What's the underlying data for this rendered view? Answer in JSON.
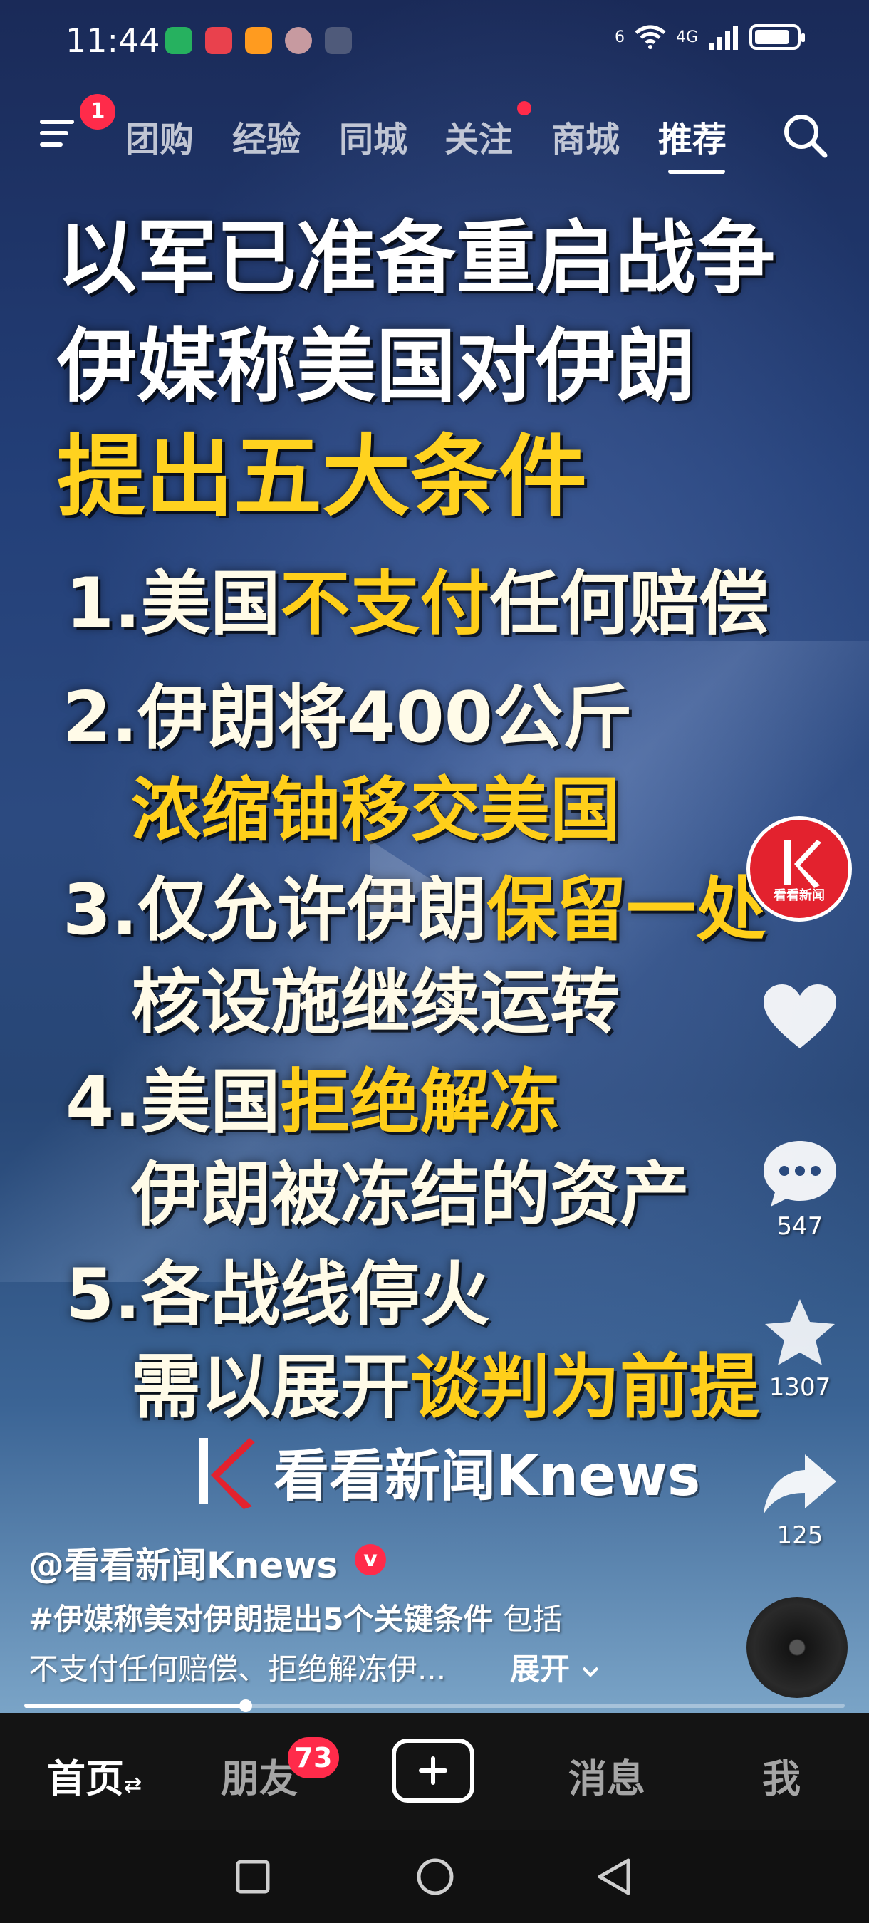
{
  "status_bar": {
    "time": "11:44",
    "network": "4G",
    "wifi_badge": "6",
    "battery_percent": 85
  },
  "top_nav": {
    "menu_badge": "1",
    "tabs": [
      {
        "label": "团购"
      },
      {
        "label": "经验"
      },
      {
        "label": "同城"
      },
      {
        "label": "关注"
      },
      {
        "label": "商城"
      },
      {
        "label": "推荐"
      }
    ],
    "active_tab": "推荐"
  },
  "video": {
    "headline_line1": "以军已准备重启战争",
    "headline_line2": "伊媒称美国对伊朗",
    "headline_line3": "提出五大条件",
    "points": [
      {
        "a": "1.美国",
        "b": "不支付",
        "c": "任何赔偿"
      },
      {
        "a": "2.伊朗将400公斤",
        "b": "",
        "c": ""
      },
      {
        "a": "",
        "b": "浓缩铀移交美国",
        "c": ""
      },
      {
        "a": "3.仅允许伊朗",
        "b": "保留一处",
        "c": ""
      },
      {
        "a": "核设施继续运转",
        "b": "",
        "c": ""
      },
      {
        "a": "4.美国",
        "b": "拒绝解冻",
        "c": ""
      },
      {
        "a": "伊朗被冻结的资产",
        "b": "",
        "c": ""
      },
      {
        "a": "5.各战线停火",
        "b": "",
        "c": ""
      },
      {
        "a": "需以展开",
        "b": "谈判为前提",
        "c": ""
      }
    ],
    "brand": "看看新闻Knews"
  },
  "actions": {
    "avatar_label": "看看新闻",
    "like_count": "",
    "comment_count": "547",
    "favorite_count": "1307",
    "share_count": "125"
  },
  "caption": {
    "author": "@看看新闻Knews",
    "verified_mark": "v",
    "hashtag": "#伊媒称美对伊朗提出5个关键条件",
    "desc_tail": " 包括",
    "line2": "不支付任何赔偿、拒绝解冻伊...",
    "expand": "展开"
  },
  "progress": {
    "fraction": 0.27
  },
  "bottom_nav": {
    "home": "首页",
    "home_suffix": "⇄",
    "friends": "朋友",
    "friends_badge": "73",
    "messages": "消息",
    "me": "我"
  },
  "colors": {
    "accent": "#ff2b4a",
    "highlight": "#ffcf1a"
  }
}
